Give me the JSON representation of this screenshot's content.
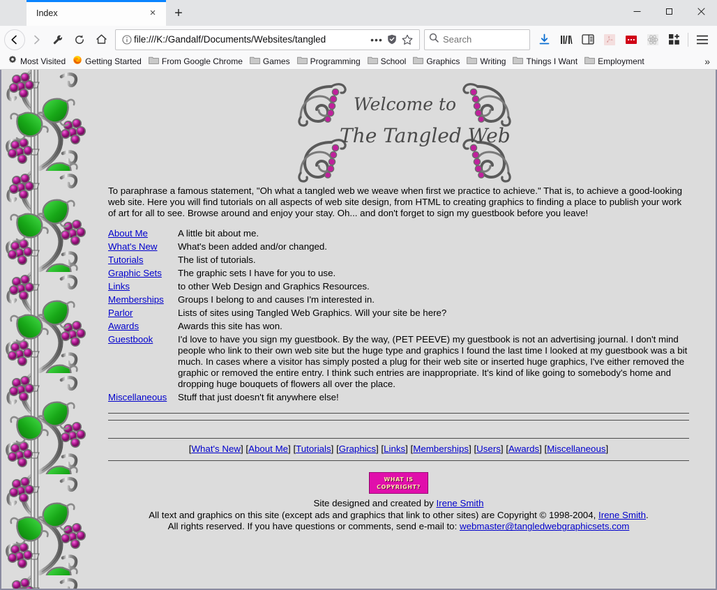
{
  "browser": {
    "tab": {
      "title": "Index",
      "close_label": "×"
    },
    "newtab_label": "+",
    "window_controls": {
      "minimize": "minimize-button",
      "maximize": "maximize-button",
      "close": "close-button"
    },
    "nav": {
      "back": "Back",
      "forward": "Forward",
      "tools": "Tools",
      "reload": "Reload",
      "home": "Home"
    },
    "url": {
      "value": "file:///K:/Gandalf/Documents/Websites/tangled",
      "identity_icon": "info-icon",
      "page_actions": "•••",
      "shield_icon": "shield-icon",
      "bookmark_icon": "star-icon"
    },
    "search": {
      "placeholder": "Search",
      "icon": "search-icon"
    },
    "toolbar_icons": [
      "downloads-icon",
      "library-icon",
      "sidebar-icon",
      "pdf-icon",
      "adblock-icon",
      "react-devtools-icon",
      "addons-icon",
      "menu-icon"
    ],
    "bookmarks": [
      {
        "label": "Most Visited",
        "icon": "gear-icon"
      },
      {
        "label": "Getting Started",
        "icon": "firefox-icon"
      },
      {
        "label": "From Google Chrome",
        "icon": "folder-icon"
      },
      {
        "label": "Games",
        "icon": "folder-icon"
      },
      {
        "label": "Programming",
        "icon": "folder-icon"
      },
      {
        "label": "School",
        "icon": "folder-icon"
      },
      {
        "label": "Graphics",
        "icon": "folder-icon"
      },
      {
        "label": "Writing",
        "icon": "folder-icon"
      },
      {
        "label": "Things I Want",
        "icon": "folder-icon"
      },
      {
        "label": "Employment",
        "icon": "folder-icon"
      }
    ],
    "bookmarks_overflow": "»"
  },
  "page": {
    "masthead": {
      "line1": "Welcome to",
      "line2": "The Tangled Web",
      "ornament": "scrollwork-vine-ornament"
    },
    "intro": "To paraphrase a famous statement, \"Oh what a tangled web we weave when first we practice to achieve.\" That is, to achieve a good-looking web site. Here you will find tutorials on all aspects of web site design, from HTML to creating graphics to finding a place to publish your work of art for all to see. Browse around and enjoy your stay. Oh... and don't forget to sign my guestbook before you leave!",
    "nav_rows": [
      {
        "link": "About Me",
        "desc": "A little bit about me."
      },
      {
        "link": "What's New",
        "desc": "What's been added and/or changed."
      },
      {
        "link": "Tutorials",
        "desc": "The list of tutorials."
      },
      {
        "link": "Graphic Sets",
        "desc": "The graphic sets I have for you to use."
      },
      {
        "link": "Links",
        "desc": "to other Web Design and Graphics Resources."
      },
      {
        "link": "Memberships",
        "desc": "Groups I belong to and causes I'm interested in."
      },
      {
        "link": "Parlor",
        "desc": "Lists of sites using Tangled Web Graphics. Will your site be here?"
      },
      {
        "link": "Awards",
        "desc": "Awards this site has won."
      },
      {
        "link": "Guestbook",
        "desc": "I'd love to have you sign my guestbook. By the way, (PET PEEVE) my guestbook is not an advertising journal. I don't mind people who link to their own web site but the huge type and graphics I found the last time I looked at my guestbook was a bit much. In cases where a visitor has simply posted a plug for their web site or inserted huge graphics, I've either removed the graphic or removed the entire entry. I think such entries are inappropriate. It's kind of like going to somebody's home and dropping huge bouquets of flowers all over the place."
      },
      {
        "link": "Miscellaneous",
        "desc": "Stuff that just doesn't fit anywhere else!"
      }
    ],
    "footer_nav": {
      "open_bracket": "[",
      "close_bracket": "]",
      "items": [
        "What's New",
        "About Me",
        "Tutorials",
        "Graphics",
        "Links",
        "Memberships",
        "Users",
        "Awards",
        "Miscellaneous"
      ]
    },
    "copyright_badge": {
      "line1": "WHAT IS",
      "line2": "COPYRIGHT?",
      "alt": "what-is-copyright-banner"
    },
    "credits": {
      "line1_prefix": "Site designed and created by ",
      "line1_link": "Irene Smith",
      "line2_prefix": "All text and graphics on this site (except ads and graphics that link to other sites) are Copyright © 1998-2004, ",
      "line2_link": "Irene Smith",
      "line2_suffix": ".",
      "line3_prefix": "All rights reserved. If you have questions or comments, send e-mail to: ",
      "line3_link": "webmaster@tangledwebgraphicsets.com"
    }
  },
  "colors": {
    "page_background": "#dcdcdc",
    "link": "#0000cc",
    "text": "#000000",
    "rule": "#4a4a4a",
    "badge_pink": "#ff1ec8",
    "badge_text": "#ffe9a8",
    "vine_silver": "#b8b8b8",
    "vine_berry": "#c020a0",
    "vine_leaf": "#18a818",
    "tab_accent": "#0a84ff"
  }
}
